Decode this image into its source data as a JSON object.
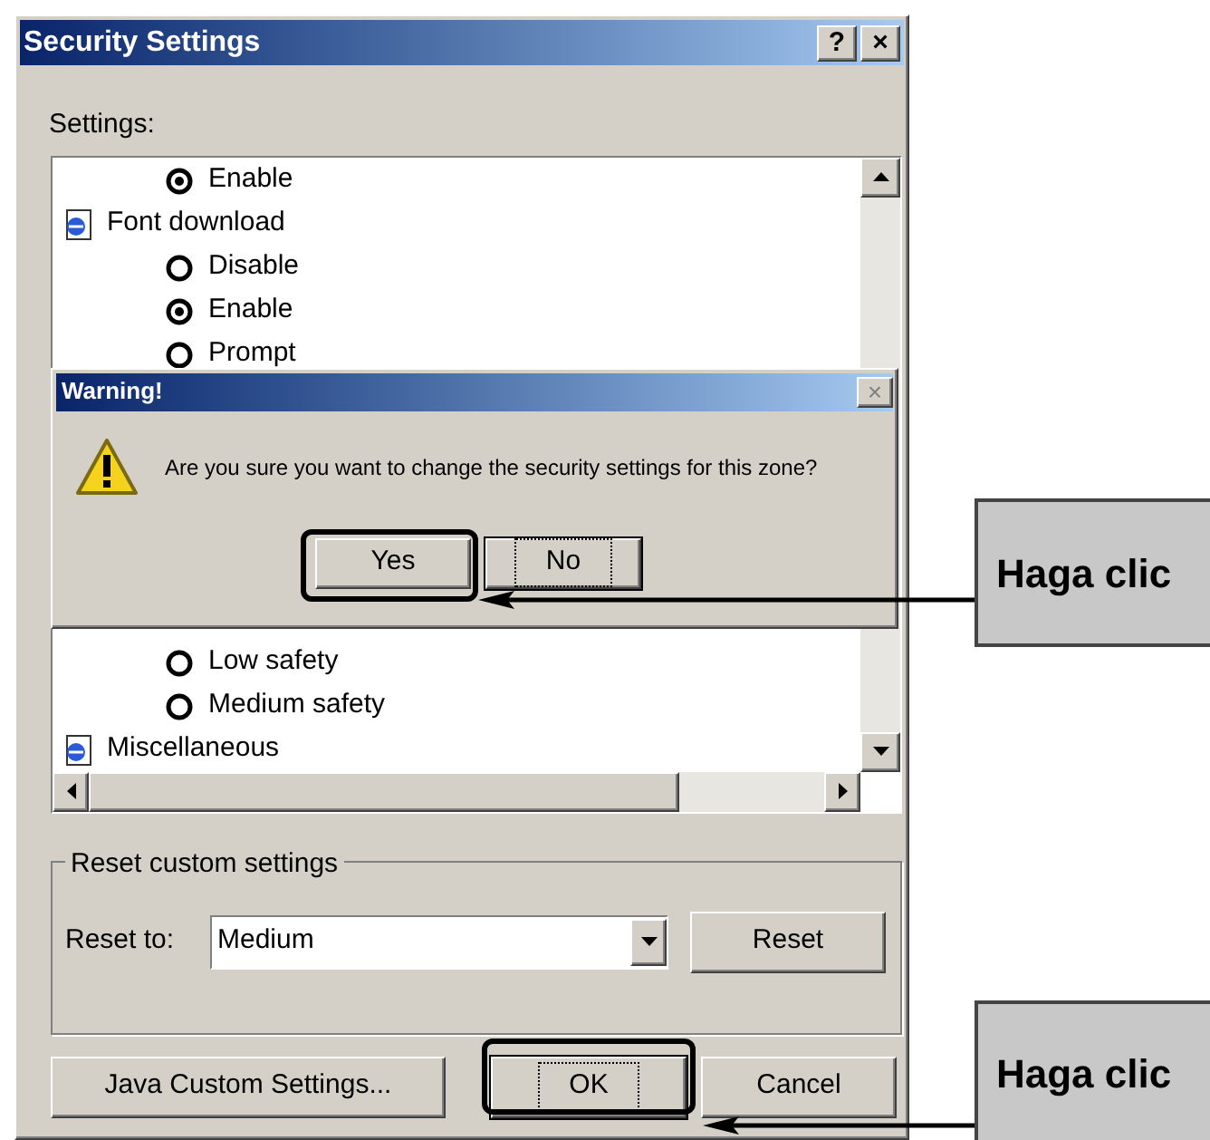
{
  "window": {
    "title": "Security Settings",
    "title_buttons": [
      "?",
      "×"
    ]
  },
  "settings_label": "Settings:",
  "settings_list": {
    "items_above": [
      {
        "kind": "radio",
        "label": "Enable",
        "selected": true
      },
      {
        "kind": "category",
        "label": "Font download"
      },
      {
        "kind": "radio",
        "label": "Disable",
        "selected": false
      },
      {
        "kind": "radio",
        "label": "Enable",
        "selected": true
      },
      {
        "kind": "radio",
        "label": "Prompt",
        "selected": false
      }
    ],
    "items_below": [
      {
        "kind": "radio",
        "label": "Low safety",
        "selected": false
      },
      {
        "kind": "radio",
        "label": "Medium safety",
        "selected": false
      },
      {
        "kind": "category",
        "label": "Miscellaneous"
      }
    ]
  },
  "warning_dialog": {
    "title": "Warning!",
    "close": "×",
    "message": "Are you sure you want to change the security settings for this zone?",
    "buttons": [
      {
        "label": "Yes",
        "focused": false,
        "highlighted": true
      },
      {
        "label": "No",
        "focused": true,
        "highlighted": false
      }
    ]
  },
  "reset_group": {
    "title": "Reset custom settings",
    "label": "Reset to:",
    "value": "Medium",
    "button": "Reset"
  },
  "footer_buttons": [
    {
      "label": "Java Custom Settings...",
      "focused": false,
      "highlighted": false
    },
    {
      "label": "OK",
      "focused": true,
      "highlighted": true
    },
    {
      "label": "Cancel",
      "focused": false,
      "highlighted": false
    }
  ],
  "callouts": [
    {
      "text": "Haga clic"
    },
    {
      "text": "Haga clic"
    }
  ]
}
